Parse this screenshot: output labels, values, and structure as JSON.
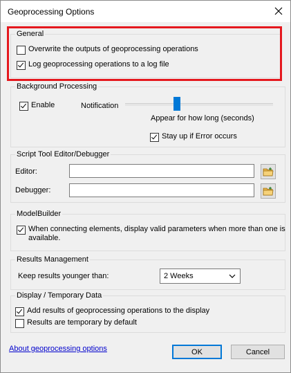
{
  "window": {
    "title": "Geoprocessing Options"
  },
  "general": {
    "title": "General",
    "overwrite": {
      "label": "Overwrite the outputs of geoprocessing operations",
      "checked": false
    },
    "log": {
      "label": "Log geoprocessing operations to a log file",
      "checked": true
    }
  },
  "background": {
    "title": "Background Processing",
    "enable": {
      "label": "Enable",
      "checked": true
    },
    "notification_label": "Notification",
    "slider_caption": "Appear for how long (seconds)",
    "stay_up": {
      "label": "Stay up if Error occurs",
      "checked": true
    }
  },
  "script_tool": {
    "title": "Script Tool Editor/Debugger",
    "editor_label": "Editor:",
    "editor_value": "",
    "debugger_label": "Debugger:",
    "debugger_value": ""
  },
  "modelbuilder": {
    "title": "ModelBuilder",
    "valid_params": {
      "label_line1": "When connecting elements, display valid parameters when more than one is",
      "label_line2": "available.",
      "checked": true
    }
  },
  "results": {
    "title": "Results Management",
    "keep_label": "Keep results younger than:",
    "keep_value": "2 Weeks"
  },
  "display": {
    "title": "Display / Temporary Data",
    "add_results": {
      "label": "Add results of geoprocessing operations to the display",
      "checked": true
    },
    "temporary": {
      "label": "Results are temporary by default",
      "checked": false
    }
  },
  "footer": {
    "about_link": "About geoprocessing options",
    "ok_label": "OK",
    "cancel_label": "Cancel"
  },
  "colors": {
    "highlight": "#e5181e",
    "accent": "#0078d7",
    "link": "#0000cc"
  }
}
